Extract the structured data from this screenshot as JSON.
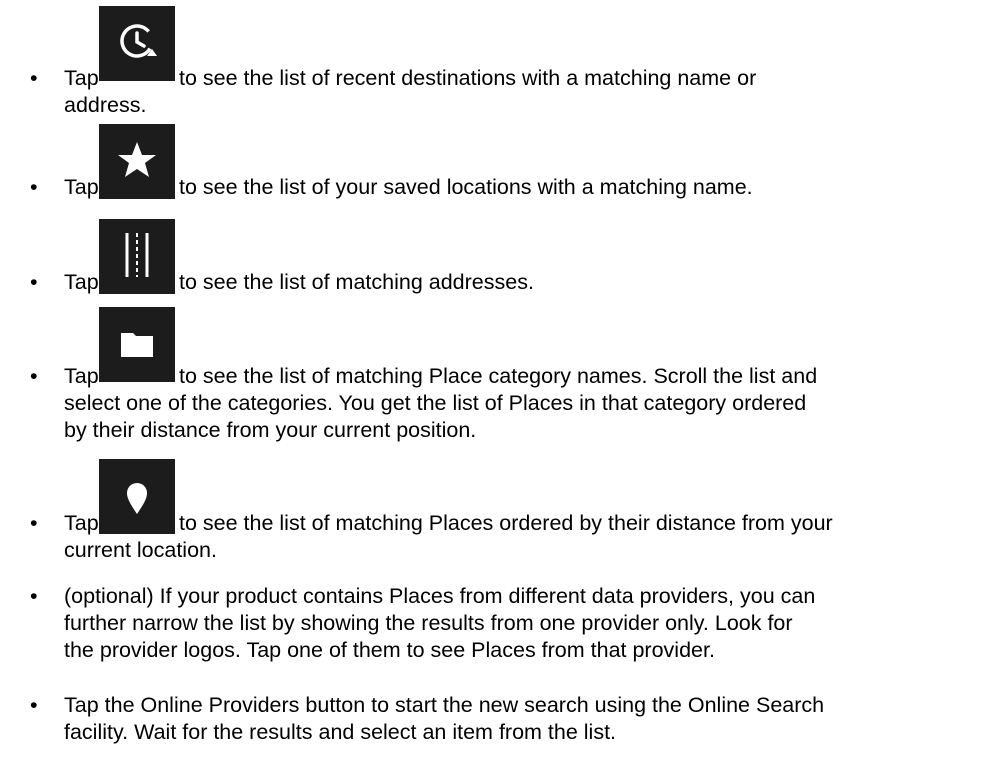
{
  "bullet_glyph": "•",
  "items": [
    {
      "icon": "history-icon",
      "lead": "Tap",
      "line1": "to see the list of recent destinations with a matching name or",
      "line2": "address."
    },
    {
      "icon": "star-icon",
      "lead": "Tap",
      "line1": "to see the list of your saved locations with a matching name."
    },
    {
      "icon": "road-icon",
      "lead": "Tap",
      "line1": "to see the list of matching addresses."
    },
    {
      "icon": "folder-icon",
      "lead": "Tap",
      "line1": "to see the list of matching Place category names. Scroll the list and",
      "line2": "select one of the categories. You get the list of Places in that category ordered",
      "line3": "by their distance from your current position."
    },
    {
      "icon": "place-pin-icon",
      "lead": "Tap",
      "line1": "to see the list of matching Places ordered by their distance from your",
      "line2": "current location."
    },
    {
      "line1": "(optional) If your product contains Places from different data providers, you can",
      "line2": "further narrow the list by showing the results from one provider only. Look for",
      "line3": "the provider logos. Tap one of them to see Places from that provider."
    },
    {
      "line1": "Tap the Online Providers button to start the new search using the Online Search",
      "line2": "facility. Wait for the results and select an item from the list."
    }
  ]
}
